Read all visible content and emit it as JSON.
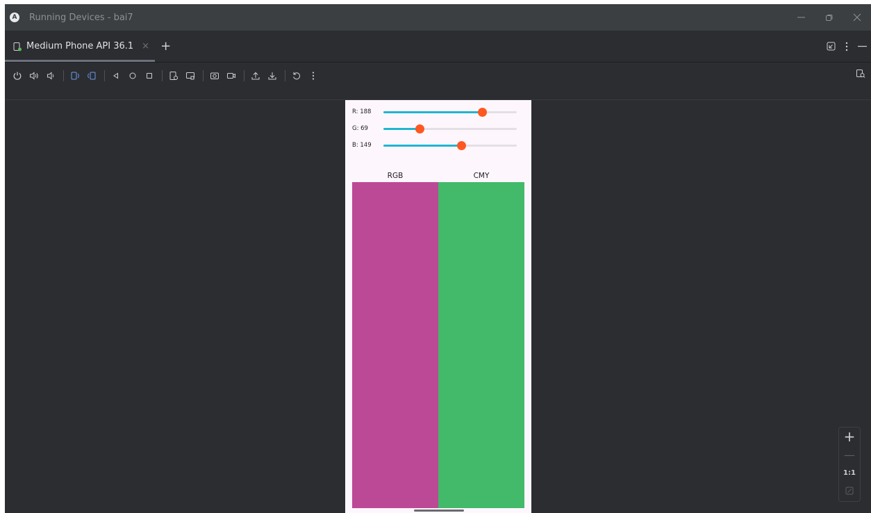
{
  "window": {
    "title": "Running Devices - bai7",
    "logo_glyph": "A"
  },
  "tabs": [
    {
      "label": "Medium Phone API 36.1",
      "active": true
    }
  ],
  "tab_add_glyph": "+",
  "tab_close_glyph": "×",
  "toolbar": {
    "icons": [
      "power-icon",
      "volume-up-icon",
      "volume-down-icon",
      "rotate-left-icon",
      "rotate-right-icon",
      "back-icon",
      "home-icon",
      "overview-icon",
      "device-snapshot-icon",
      "device-frame-icon",
      "screenshot-icon",
      "screen-record-icon",
      "upload-icon",
      "download-icon",
      "reset-icon",
      "more-icon"
    ],
    "accent_color": "#6e9af2"
  },
  "device": {
    "sliders": [
      {
        "label": "R: 188",
        "value": 188,
        "max": 255
      },
      {
        "label": "G: 69",
        "value": 69,
        "max": 255
      },
      {
        "label": "B: 149",
        "value": 149,
        "max": 255
      }
    ],
    "slider_fill_color": "#1eb6cf",
    "slider_thumb_color": "#ff5722",
    "columns": [
      {
        "label": "RGB",
        "color": "#bc4995"
      },
      {
        "label": "CMY",
        "color": "#43ba6a"
      }
    ]
  },
  "zoom": {
    "plus": "+",
    "minus": "—",
    "actual": "1:1"
  }
}
